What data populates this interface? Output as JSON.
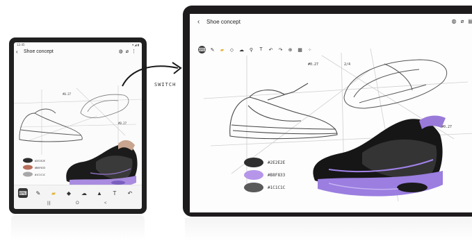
{
  "phone": {
    "status_time": "12:45",
    "status_right": "▾ ◢ ▮",
    "title": "Shoe concept",
    "header_icons": [
      "palette-icon",
      "attach-icon",
      "more-icon"
    ],
    "swatches": [
      "#2E2E2E",
      "#B96F5C",
      "#A7A7A7"
    ],
    "swatch_codes": [
      "#2E2E2E",
      "#B8F033",
      "#1C1C1C"
    ],
    "annotations": [
      "#0.27",
      "#0.27"
    ],
    "toolbar": [
      "keyboard-icon",
      "pen-icon",
      "highlighter-icon",
      "eraser-icon",
      "lasso-icon",
      "color-picker-icon",
      "text-style-icon",
      "undo-icon"
    ],
    "nav": [
      "|||",
      "O",
      "<"
    ]
  },
  "switch_label": "SWITCH",
  "tablet": {
    "title": "Shoe concept",
    "header_icons": [
      "palette-icon",
      "attach-icon",
      "menu-icon"
    ],
    "toolbar": [
      "keyboard-icon",
      "pen-icon",
      "highlighter-icon",
      "eraser-icon",
      "lasso-icon",
      "color-picker-icon",
      "text-icon",
      "undo-icon",
      "redo-icon",
      "insert-icon",
      "image-icon",
      "more-icon"
    ],
    "annotations": [
      "#0.27",
      "2/4",
      "#0.27"
    ],
    "swatches": [
      "#2E2E2E",
      "#B696E9",
      "#5A5A5A"
    ],
    "swatch_codes": [
      "#2E2E2E",
      "#B8F833",
      "#1C1C1C"
    ]
  }
}
